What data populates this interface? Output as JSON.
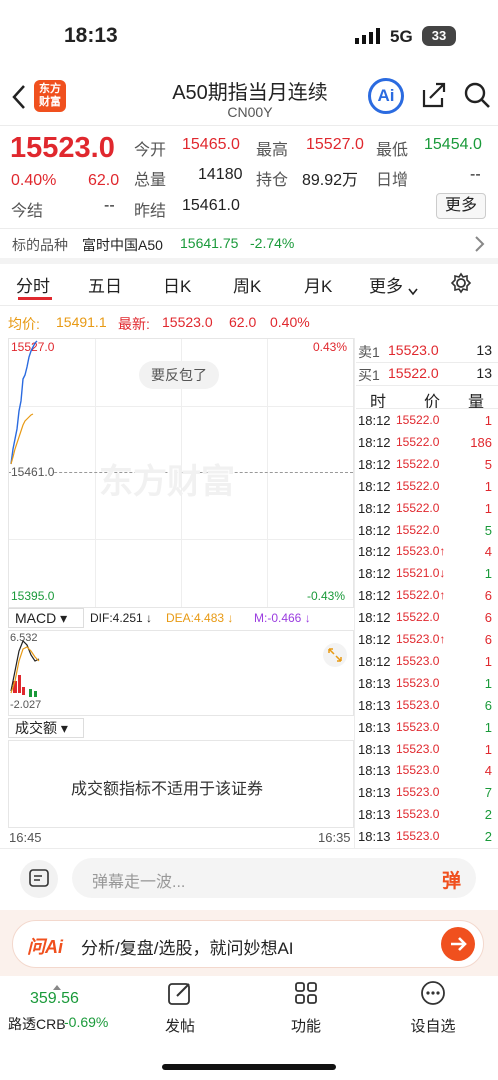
{
  "status": {
    "time": "18:13",
    "network": "5G",
    "battery": "33"
  },
  "header": {
    "logo_line1": "东方",
    "logo_line2": "财富",
    "title": "A50期指当月连续",
    "code": "CN00Y",
    "ai_label": "Ai"
  },
  "quote": {
    "price": "15523.0",
    "pct": "0.40%",
    "chg": "62.0",
    "open_label": "今开",
    "open": "15465.0",
    "high_label": "最高",
    "high": "15527.0",
    "low_label": "最低",
    "low": "15454.0",
    "vol_label": "总量",
    "vol": "14180",
    "oi_label": "持仓",
    "oi": "89.92万",
    "daily_label": "日增",
    "daily": "--",
    "settle_label": "今结",
    "settle": "--",
    "prev_label": "昨结",
    "prev": "15461.0",
    "more": "更多"
  },
  "underlying": {
    "label": "标的品种",
    "name": "富时中国A50",
    "value": "15641.75",
    "pct": "-2.74%"
  },
  "tabs": [
    "分时",
    "五日",
    "日K",
    "周K",
    "月K",
    "更多"
  ],
  "avg_line": {
    "avg_label": "均价:",
    "avg": "15491.1",
    "last_label": "最新:",
    "last": "15523.0",
    "chg": "62.0",
    "pct": "0.40%"
  },
  "chart": {
    "top_price": "15527.0",
    "top_pct": "0.43%",
    "mid_price": "15461.0",
    "bottom_price": "15395.0",
    "bottom_pct": "-0.43%",
    "tooltip": "要反包了",
    "watermark": "东方财富"
  },
  "macd": {
    "label": "MACD",
    "dif": "DIF:4.251 ↓",
    "dea": "DEA:4.483 ↓",
    "m": "M:-0.466 ↓",
    "top": "6.532",
    "bottom": "-2.027"
  },
  "volume": {
    "label": "成交额",
    "msg": "成交额指标不适用于该证券",
    "time_start": "16:45",
    "time_end": "16:35"
  },
  "orderbook": {
    "sell_label": "卖1",
    "sell_price": "15523.0",
    "sell_qty": "13",
    "buy_label": "买1",
    "buy_price": "15522.0",
    "buy_qty": "13",
    "h_time": "时",
    "h_price": "价",
    "h_qty": "量"
  },
  "trades": [
    {
      "t": "18:12",
      "p": "15522.0",
      "q": "1",
      "c": "red"
    },
    {
      "t": "18:12",
      "p": "15522.0",
      "q": "186",
      "c": "red"
    },
    {
      "t": "18:12",
      "p": "15522.0",
      "q": "5",
      "c": "red"
    },
    {
      "t": "18:12",
      "p": "15522.0",
      "q": "1",
      "c": "red"
    },
    {
      "t": "18:12",
      "p": "15522.0",
      "q": "1",
      "c": "red"
    },
    {
      "t": "18:12",
      "p": "15522.0",
      "q": "5",
      "c": "green"
    },
    {
      "t": "18:12",
      "p": "15523.0↑",
      "q": "4",
      "c": "red"
    },
    {
      "t": "18:12",
      "p": "15521.0↓",
      "q": "1",
      "c": "green"
    },
    {
      "t": "18:12",
      "p": "15522.0↑",
      "q": "6",
      "c": "red"
    },
    {
      "t": "18:12",
      "p": "15522.0",
      "q": "6",
      "c": "red"
    },
    {
      "t": "18:12",
      "p": "15523.0↑",
      "q": "6",
      "c": "red"
    },
    {
      "t": "18:12",
      "p": "15523.0",
      "q": "1",
      "c": "red"
    },
    {
      "t": "18:13",
      "p": "15523.0",
      "q": "1",
      "c": "green"
    },
    {
      "t": "18:13",
      "p": "15523.0",
      "q": "6",
      "c": "green"
    },
    {
      "t": "18:13",
      "p": "15523.0",
      "q": "1",
      "c": "green"
    },
    {
      "t": "18:13",
      "p": "15523.0",
      "q": "1",
      "c": "red"
    },
    {
      "t": "18:13",
      "p": "15523.0",
      "q": "4",
      "c": "red"
    },
    {
      "t": "18:13",
      "p": "15523.0",
      "q": "7",
      "c": "green"
    },
    {
      "t": "18:13",
      "p": "15523.0",
      "q": "2",
      "c": "green"
    },
    {
      "t": "18:13",
      "p": "15523.0",
      "q": "2",
      "c": "green"
    }
  ],
  "danmu": {
    "placeholder": "弹幕走一波...",
    "send": "弹"
  },
  "ai_bar": {
    "brand": "问Ai",
    "text": "分析/复盘/选股，就问妙想AI"
  },
  "bottom": {
    "index_value": "359.56",
    "index_name": "路透CRB",
    "index_pct": "-0.69%",
    "post": "发帖",
    "func": "功能",
    "watch": "设自选"
  },
  "colors": {
    "red": "#e0282e",
    "green": "#1a9a3a",
    "accent": "#f0501e",
    "blue": "#2b6be0"
  }
}
